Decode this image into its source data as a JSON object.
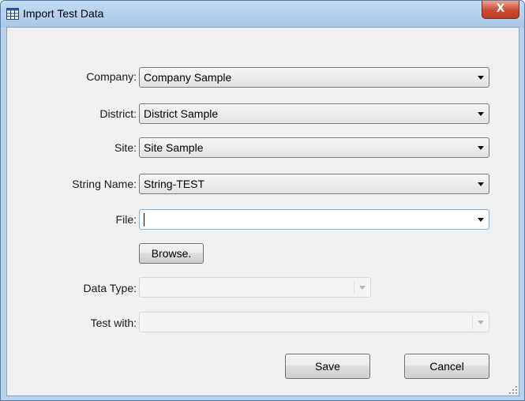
{
  "window": {
    "title": "Import Test Data",
    "close_glyph": "X",
    "icon": "table-icon"
  },
  "form": {
    "company": {
      "label": "Company:",
      "value": "Company Sample"
    },
    "district": {
      "label": "District:",
      "value": "District Sample"
    },
    "site": {
      "label": "Site:",
      "value": "Site Sample"
    },
    "string_name": {
      "label": "String Name:",
      "value": "String-TEST"
    },
    "file": {
      "label": "File:",
      "value": ""
    },
    "browse_label": "Browse.",
    "data_type": {
      "label": "Data Type:",
      "value": ""
    },
    "test_with": {
      "label": "Test with:",
      "value": ""
    }
  },
  "actions": {
    "save_label": "Save",
    "cancel_label": "Cancel"
  }
}
